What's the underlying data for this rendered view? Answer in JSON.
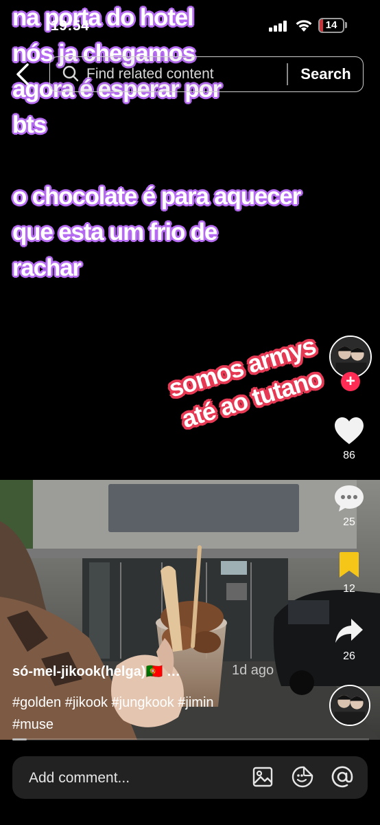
{
  "status_bar": {
    "time": "19:54",
    "battery": "14",
    "battery_level": 0.14
  },
  "search": {
    "placeholder": "Find related content",
    "button_label": "Search"
  },
  "caption": {
    "text": "na porta do hotel\nnós ja chegamos\nagora é esperar por\nbts\n\no chocolate é para aquecer\nque esta um frio de\nrachar"
  },
  "sticker": {
    "line1": "somos armys",
    "line2": "até ao tutano"
  },
  "actions": {
    "likes": "86",
    "comments": "25",
    "favorites": "12",
    "shares": "26"
  },
  "post": {
    "author": "só-mel-jikook(helga)🇵🇹 …",
    "time_ago": "1d ago",
    "hashtags": "#golden #jikook #jungkook #jimin\n#muse",
    "progress": 0.04
  },
  "comment_bar": {
    "placeholder": "Add comment..."
  },
  "colors": {
    "caption_glow": "#b66df0",
    "sticker_red": "#e63a55",
    "favorite_yellow": "#f5c518",
    "follow_plus": "#fe2c55",
    "battery_red": "#c7343a"
  }
}
